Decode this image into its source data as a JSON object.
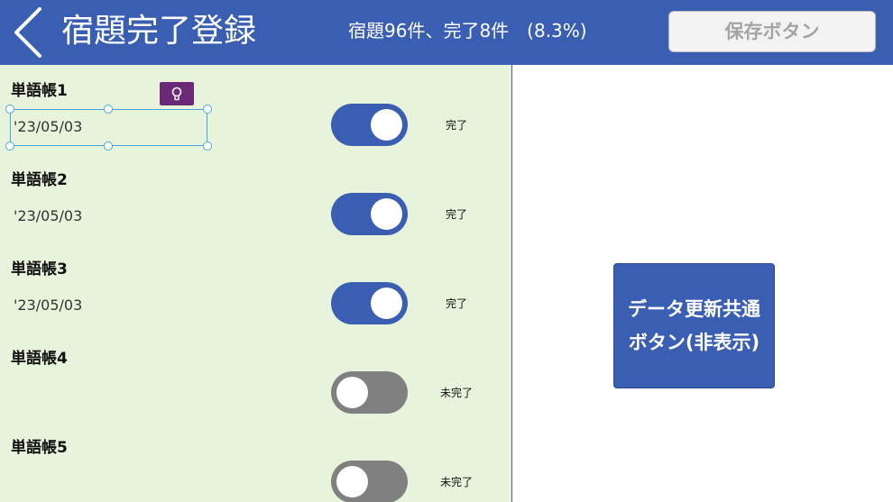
{
  "header": {
    "title": "宿題完了登録",
    "summary": "宿題96件、完了8件　(8.3%)",
    "save_label": "保存ボタン",
    "back_icon": "chevron-left-icon"
  },
  "colors": {
    "header_bg": "#3a5fb2",
    "row_bg": "#e7f3db",
    "toggle_on": "#3a5fb2",
    "toggle_off": "#808080",
    "selection": "#4aa8d8",
    "idea_button": "#6b2a78"
  },
  "gallery": {
    "rows": [
      {
        "name": "単語帳1",
        "date": "'23/05/03",
        "toggle_on": true,
        "status": "完了"
      },
      {
        "name": "単語帳2",
        "date": "'23/05/03",
        "toggle_on": true,
        "status": "完了"
      },
      {
        "name": "単語帳3",
        "date": "'23/05/03",
        "toggle_on": true,
        "status": "完了"
      },
      {
        "name": "単語帳4",
        "date": "",
        "toggle_on": false,
        "status": "未完了"
      },
      {
        "name": "単語帳5",
        "date": "",
        "toggle_on": false,
        "status": "未完了"
      }
    ],
    "idea_icon": "lightbulb-icon"
  },
  "update_button": {
    "line1": "データ更新共通",
    "line2": "ボタン(非表示)"
  }
}
